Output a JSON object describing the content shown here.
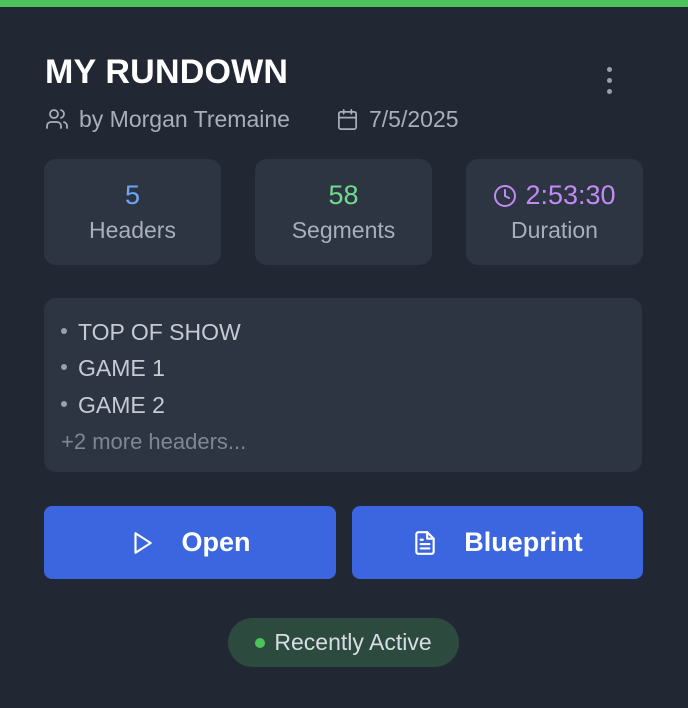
{
  "card": {
    "title": "MY RUNDOWN",
    "author": "by Morgan Tremaine",
    "date": "7/5/2025",
    "accent_color": "#4cc35a"
  },
  "stats": [
    {
      "value": "5",
      "label": "Headers",
      "color": "#6ea6f5"
    },
    {
      "value": "58",
      "label": "Segments",
      "color": "#6fdc8c"
    },
    {
      "value": "2:53:30",
      "label": "Duration",
      "color": "#c18bf6",
      "icon": "clock-icon"
    }
  ],
  "headers_preview": {
    "items": [
      "TOP OF SHOW",
      "GAME 1",
      "GAME 2"
    ],
    "more": "+2 more headers..."
  },
  "actions": {
    "open_label": "Open",
    "blueprint_label": "Blueprint",
    "button_color": "#3b66e0"
  },
  "status": {
    "label": "Recently Active",
    "dot_color": "#4cc35a"
  },
  "icons": [
    "users-icon",
    "calendar-icon",
    "clock-icon",
    "play-icon",
    "document-icon",
    "more-vertical-icon"
  ]
}
